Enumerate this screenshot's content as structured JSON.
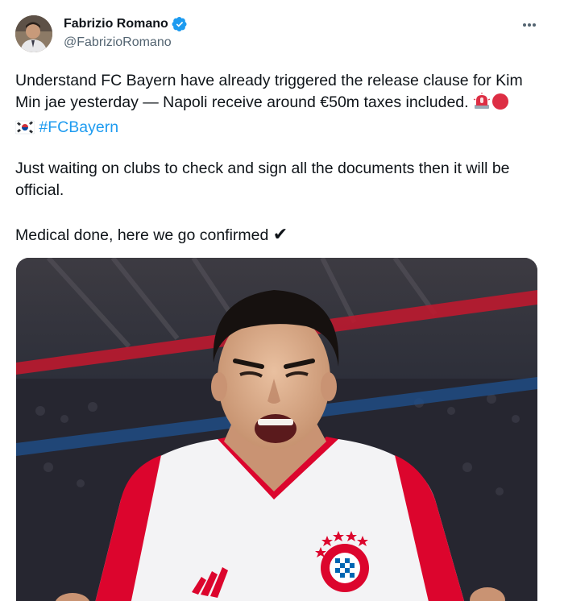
{
  "author": {
    "display_name": "Fabrizio Romano",
    "handle": "@FabrizioRomano",
    "verified": true,
    "avatar_icon": "profile-photo"
  },
  "tweet": {
    "line1a": "Understand FC Bayern have already triggered the release clause for Kim",
    "line1b": "Min jae yesterday — Napoli receive around €50m taxes included.",
    "emojis_line1": [
      "rotating-light-emoji",
      "red-circle-emoji"
    ],
    "emoji_line2": "south-korea-flag-emoji",
    "hashtag": "#FCBayern",
    "paragraph2a": "Just waiting on clubs to check and sign all the documents then it will be",
    "paragraph2b": "official.",
    "paragraph3": "Medical done, here we go confirmed",
    "checkmark": "✔"
  },
  "media": {
    "description_icon": "player-photo",
    "jersey_brand": "adidas",
    "crest": "FC BAYERN MÜNCHEN"
  },
  "colors": {
    "link": "#1d9bf0",
    "verified": "#1d9bf0",
    "secondary_text": "#536471",
    "bayern_red": "#dc052d"
  }
}
